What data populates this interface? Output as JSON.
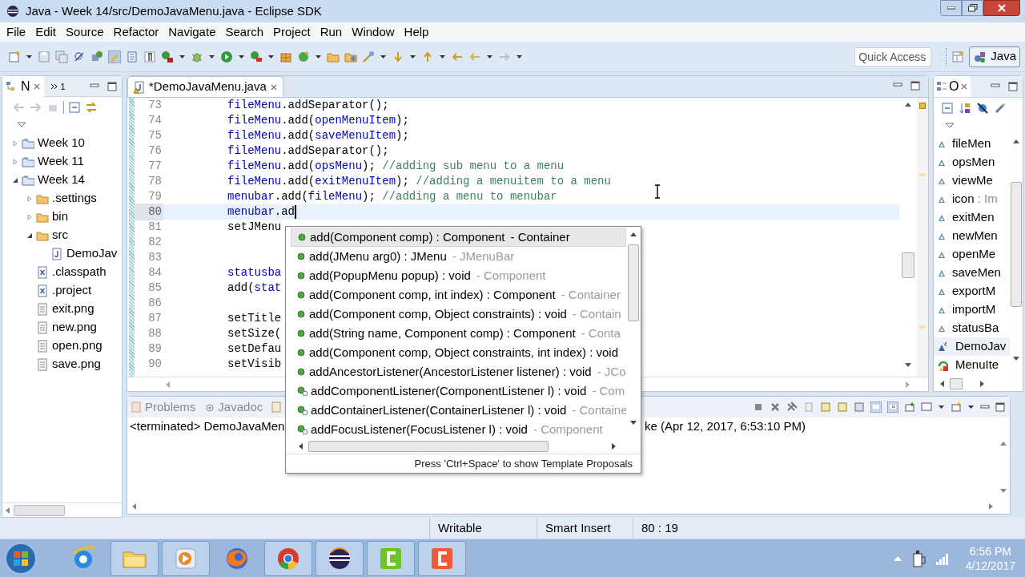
{
  "window": {
    "title": "Java - Week 14/src/DemoJavaMenu.java - Eclipse SDK"
  },
  "menu": [
    "File",
    "Edit",
    "Source",
    "Refactor",
    "Navigate",
    "Search",
    "Project",
    "Run",
    "Window",
    "Help"
  ],
  "quick_access": {
    "placeholder": "Quick Access"
  },
  "perspective": {
    "label": "Java",
    "selected": true
  },
  "package_explorer": {
    "tabs": [
      {
        "label": "N",
        "selected": true
      },
      {
        "label": "1",
        "selected": false
      }
    ],
    "tree": [
      {
        "label": "Week 10",
        "kind": "project",
        "expanded": false
      },
      {
        "label": "Week 11",
        "kind": "project",
        "expanded": false
      },
      {
        "label": "Week 14",
        "kind": "project",
        "expanded": true,
        "children": [
          {
            "label": ".settings",
            "kind": "folder",
            "expanded": false
          },
          {
            "label": "bin",
            "kind": "folder",
            "expanded": false
          },
          {
            "label": "src",
            "kind": "folder",
            "expanded": true,
            "children": [
              {
                "label": "DemoJav",
                "kind": "java"
              }
            ]
          },
          {
            "label": ".classpath",
            "kind": "xml"
          },
          {
            "label": ".project",
            "kind": "xml"
          },
          {
            "label": "exit.png",
            "kind": "file"
          },
          {
            "label": "new.png",
            "kind": "file"
          },
          {
            "label": "open.png",
            "kind": "file"
          },
          {
            "label": "save.png",
            "kind": "file"
          }
        ]
      }
    ]
  },
  "editor": {
    "tab": {
      "label": "*DemoJavaMenu.java",
      "dirty": true
    },
    "lines": [
      {
        "number": "73",
        "current": false,
        "segments": [
          {
            "text": "fileMenu",
            "kind": "field"
          },
          {
            "text": ".addSeparator();",
            "kind": "plain"
          }
        ]
      },
      {
        "number": "74",
        "current": false,
        "segments": [
          {
            "text": "fileMenu",
            "kind": "field"
          },
          {
            "text": ".add(",
            "kind": "plain"
          },
          {
            "text": "openMenuItem",
            "kind": "field"
          },
          {
            "text": ");",
            "kind": "plain"
          }
        ]
      },
      {
        "number": "75",
        "current": false,
        "segments": [
          {
            "text": "fileMenu",
            "kind": "field"
          },
          {
            "text": ".add(",
            "kind": "plain"
          },
          {
            "text": "saveMenuItem",
            "kind": "field"
          },
          {
            "text": ");",
            "kind": "plain"
          }
        ]
      },
      {
        "number": "76",
        "current": false,
        "segments": [
          {
            "text": "fileMenu",
            "kind": "field"
          },
          {
            "text": ".addSeparator();",
            "kind": "plain"
          }
        ]
      },
      {
        "number": "77",
        "current": false,
        "segments": [
          {
            "text": "fileMenu",
            "kind": "field"
          },
          {
            "text": ".add(",
            "kind": "plain"
          },
          {
            "text": "opsMenu",
            "kind": "field"
          },
          {
            "text": "); ",
            "kind": "plain"
          },
          {
            "text": "//adding sub menu to a menu",
            "kind": "comment"
          }
        ]
      },
      {
        "number": "78",
        "current": false,
        "segments": [
          {
            "text": "fileMenu",
            "kind": "field"
          },
          {
            "text": ".add(",
            "kind": "plain"
          },
          {
            "text": "exitMenuItem",
            "kind": "field"
          },
          {
            "text": "); ",
            "kind": "plain"
          },
          {
            "text": "//adding a menuitem to a menu",
            "kind": "comment"
          }
        ]
      },
      {
        "number": "79",
        "current": false,
        "segments": [
          {
            "text": "menubar",
            "kind": "field"
          },
          {
            "text": ".add(",
            "kind": "plain"
          },
          {
            "text": "fileMenu",
            "kind": "field"
          },
          {
            "text": "); ",
            "kind": "plain"
          },
          {
            "text": "//adding a menu to menubar",
            "kind": "comment"
          }
        ]
      },
      {
        "number": "80",
        "current": true,
        "segments": [
          {
            "text": "menubar",
            "kind": "field"
          },
          {
            "text": ".ad",
            "kind": "plain"
          }
        ]
      },
      {
        "number": "81",
        "current": false,
        "segments": [
          {
            "text": "setJMenu",
            "kind": "plain"
          }
        ]
      },
      {
        "number": "82",
        "current": false
      },
      {
        "number": "83",
        "current": false
      },
      {
        "number": "84",
        "current": false,
        "segments": [
          {
            "text": "statusba",
            "kind": "field"
          }
        ]
      },
      {
        "number": "85",
        "current": false,
        "segments": [
          {
            "text": "add(",
            "kind": "plain"
          },
          {
            "text": "stat",
            "kind": "field"
          }
        ]
      },
      {
        "number": "86",
        "current": false
      },
      {
        "number": "87",
        "current": false,
        "segments": [
          {
            "text": "setTitle",
            "kind": "plain"
          }
        ]
      },
      {
        "number": "88",
        "current": false,
        "segments": [
          {
            "text": "setSize(",
            "kind": "plain"
          }
        ]
      },
      {
        "number": "89",
        "current": false,
        "segments": [
          {
            "text": "setDefau",
            "kind": "plain"
          }
        ]
      },
      {
        "number": "90",
        "current": false,
        "segments": [
          {
            "text": "setVisib",
            "kind": "plain"
          }
        ]
      }
    ]
  },
  "completion": {
    "items": [
      {
        "kind": "method",
        "signature": "add(Component comp) : Component",
        "owner": "- Container",
        "selected": true
      },
      {
        "kind": "method",
        "signature": "add(JMenu arg0) : JMenu",
        "owner": "- JMenuBar",
        "selected": false
      },
      {
        "kind": "method",
        "signature": "add(PopupMenu popup) : void",
        "owner": "- Component",
        "selected": false
      },
      {
        "kind": "method",
        "signature": "add(Component comp, int index) : Component",
        "owner": "- Container",
        "selected": false
      },
      {
        "kind": "method",
        "signature": "add(Component comp, Object constraints) : void",
        "owner": "- Contain",
        "selected": false
      },
      {
        "kind": "method",
        "signature": "add(String name, Component comp) : Component",
        "owner": "- Conta",
        "selected": false
      },
      {
        "kind": "method",
        "signature": "add(Component comp, Object constraints, int index) : void",
        "selected": false
      },
      {
        "kind": "method",
        "signature": "addAncestorListener(AncestorListener listener) : void",
        "owner": "- JCo",
        "selected": false
      },
      {
        "kind": "synchronized",
        "signature": "addComponentListener(ComponentListener l) : void",
        "owner": "- Com",
        "selected": false
      },
      {
        "kind": "synchronized",
        "signature": "addContainerListener(ContainerListener l) : void",
        "owner": "- Containe",
        "selected": false
      },
      {
        "kind": "synchronized",
        "signature": "addFocusListener(FocusListener l) : void",
        "owner": "- Component",
        "selected": false
      }
    ],
    "footer": "Press 'Ctrl+Space' to show Template Proposals"
  },
  "outline": {
    "tab": {
      "label": "O"
    },
    "items": [
      {
        "kind": "field",
        "label": "fileMen"
      },
      {
        "kind": "field",
        "label": "opsMen"
      },
      {
        "kind": "field",
        "label": "viewMe"
      },
      {
        "kind": "field",
        "label": "icon",
        "type": ": Im"
      },
      {
        "kind": "field",
        "label": "exitMen"
      },
      {
        "kind": "field",
        "label": "newMen"
      },
      {
        "kind": "field",
        "label": "openMe"
      },
      {
        "kind": "field",
        "label": "saveMen"
      },
      {
        "kind": "field",
        "label": "exportM"
      },
      {
        "kind": "field",
        "label": "importM"
      },
      {
        "kind": "field",
        "label": "statusBa"
      },
      {
        "kind": "class",
        "label": "DemoJav"
      },
      {
        "kind": "inner",
        "label": "MenuIte"
      }
    ]
  },
  "console": {
    "tabs": [
      {
        "label": "Problems",
        "selected": false
      },
      {
        "label": "Javadoc",
        "selected": false
      }
    ],
    "left_text": "<terminated> DemoJavaMen",
    "right_text": "ke (Apr 12, 2017, 6:53:10 PM)"
  },
  "status_bar": [
    "Writable",
    "Smart Insert",
    "80 : 19"
  ],
  "taskbar": {
    "apps": [
      {
        "kind": "ie",
        "running": false
      },
      {
        "kind": "explorer",
        "running": true
      },
      {
        "kind": "media",
        "running": true
      },
      {
        "kind": "firefox",
        "running": false
      },
      {
        "kind": "chrome",
        "running": true
      },
      {
        "kind": "eclipse",
        "running": true
      },
      {
        "kind": "recorder",
        "running": true
      },
      {
        "kind": "studio",
        "running": true
      }
    ],
    "time": "6:56 PM",
    "date": "4/12/2017"
  }
}
